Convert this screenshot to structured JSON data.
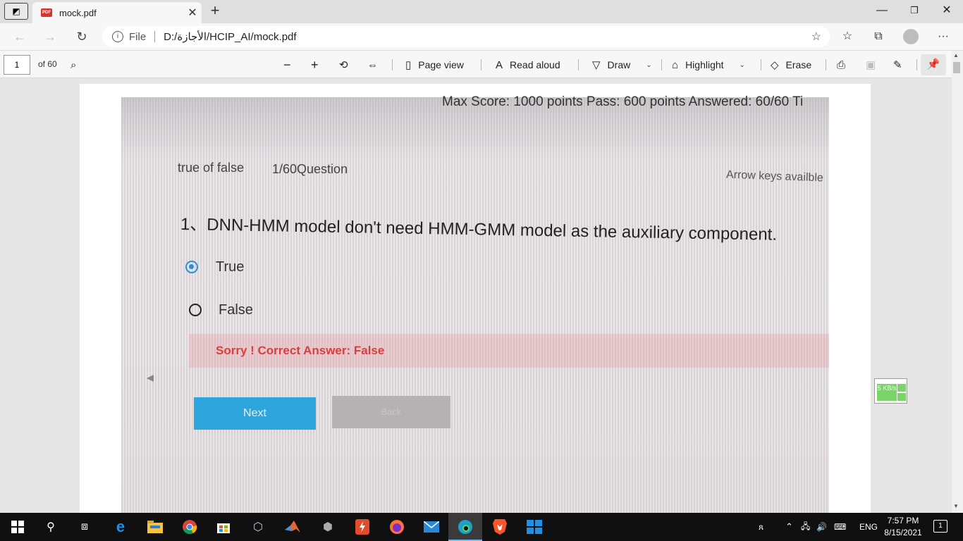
{
  "browser": {
    "tab_title": "mock.pdf",
    "tab_close": "✕",
    "new_tab": "+",
    "minimize": "—",
    "maximize": "❐",
    "close": "✕",
    "back": "←",
    "forward": "→",
    "refresh": "↻",
    "file_label": "File",
    "url": "D:/الأجازة/HCIP_AI/mock.pdf",
    "more": "···"
  },
  "pdf_toolbar": {
    "page_number": "1",
    "of_pages": "of 60",
    "page_view": "Page view",
    "read_aloud": "Read aloud",
    "draw": "Draw",
    "highlight": "Highlight",
    "erase": "Erase"
  },
  "document": {
    "score_line": "Max Score:  1000 points   Pass:  600 points   Answered:  60/60   Ti",
    "question_type": "true of false",
    "question_number": "1/60Question",
    "arrow_hint": "Arrow keys availble",
    "question": "1、DNN-HMM model don't need HMM-GMM model as the auxiliary component.",
    "options": [
      {
        "label": "True",
        "selected": true
      },
      {
        "label": "False",
        "selected": false
      }
    ],
    "feedback": "Sorry !  Correct Answer:  False",
    "next_button": "Next",
    "back_button": "Back"
  },
  "net_widget": {
    "speed": "5 KB/s"
  },
  "taskbar": {
    "language": "ENG",
    "time": "7:57 PM",
    "date": "8/15/2021",
    "notifications": "1"
  },
  "colors": {
    "accent_blue": "#2ea6dd",
    "error_red": "#d8403e",
    "radio_selected": "#2b8fd8"
  }
}
